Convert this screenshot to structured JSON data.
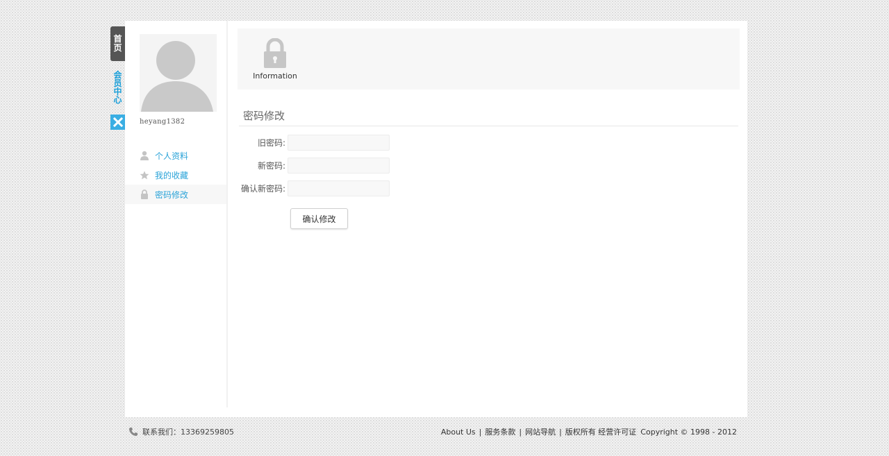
{
  "side_tabs": {
    "home_label": "首页",
    "member_label": "会员中心"
  },
  "profile": {
    "username": "heyang1382"
  },
  "menu": {
    "items": [
      {
        "label": "个人资料",
        "icon": "user-icon"
      },
      {
        "label": "我的收藏",
        "icon": "star-icon"
      },
      {
        "label": "密码修改",
        "icon": "lock-icon"
      }
    ]
  },
  "banner": {
    "info_label": "Information",
    "icon": "lock-icon"
  },
  "form": {
    "title": "密码修改",
    "old_password_label": "旧密码:",
    "new_password_label": "新密码:",
    "confirm_password_label": "确认新密码:",
    "submit_label": "确认修改"
  },
  "footer": {
    "contact_label": "联系我们：",
    "phone": "13369259805",
    "links": [
      "About Us",
      "服务条款",
      "网站导航",
      "版权所有 经营许可证"
    ],
    "copyright": "Copyright © 1998 - 2012"
  },
  "colors": {
    "accent": "#2aa3d8",
    "home_tab": "#555555",
    "close_tab": "#3aaee3"
  }
}
